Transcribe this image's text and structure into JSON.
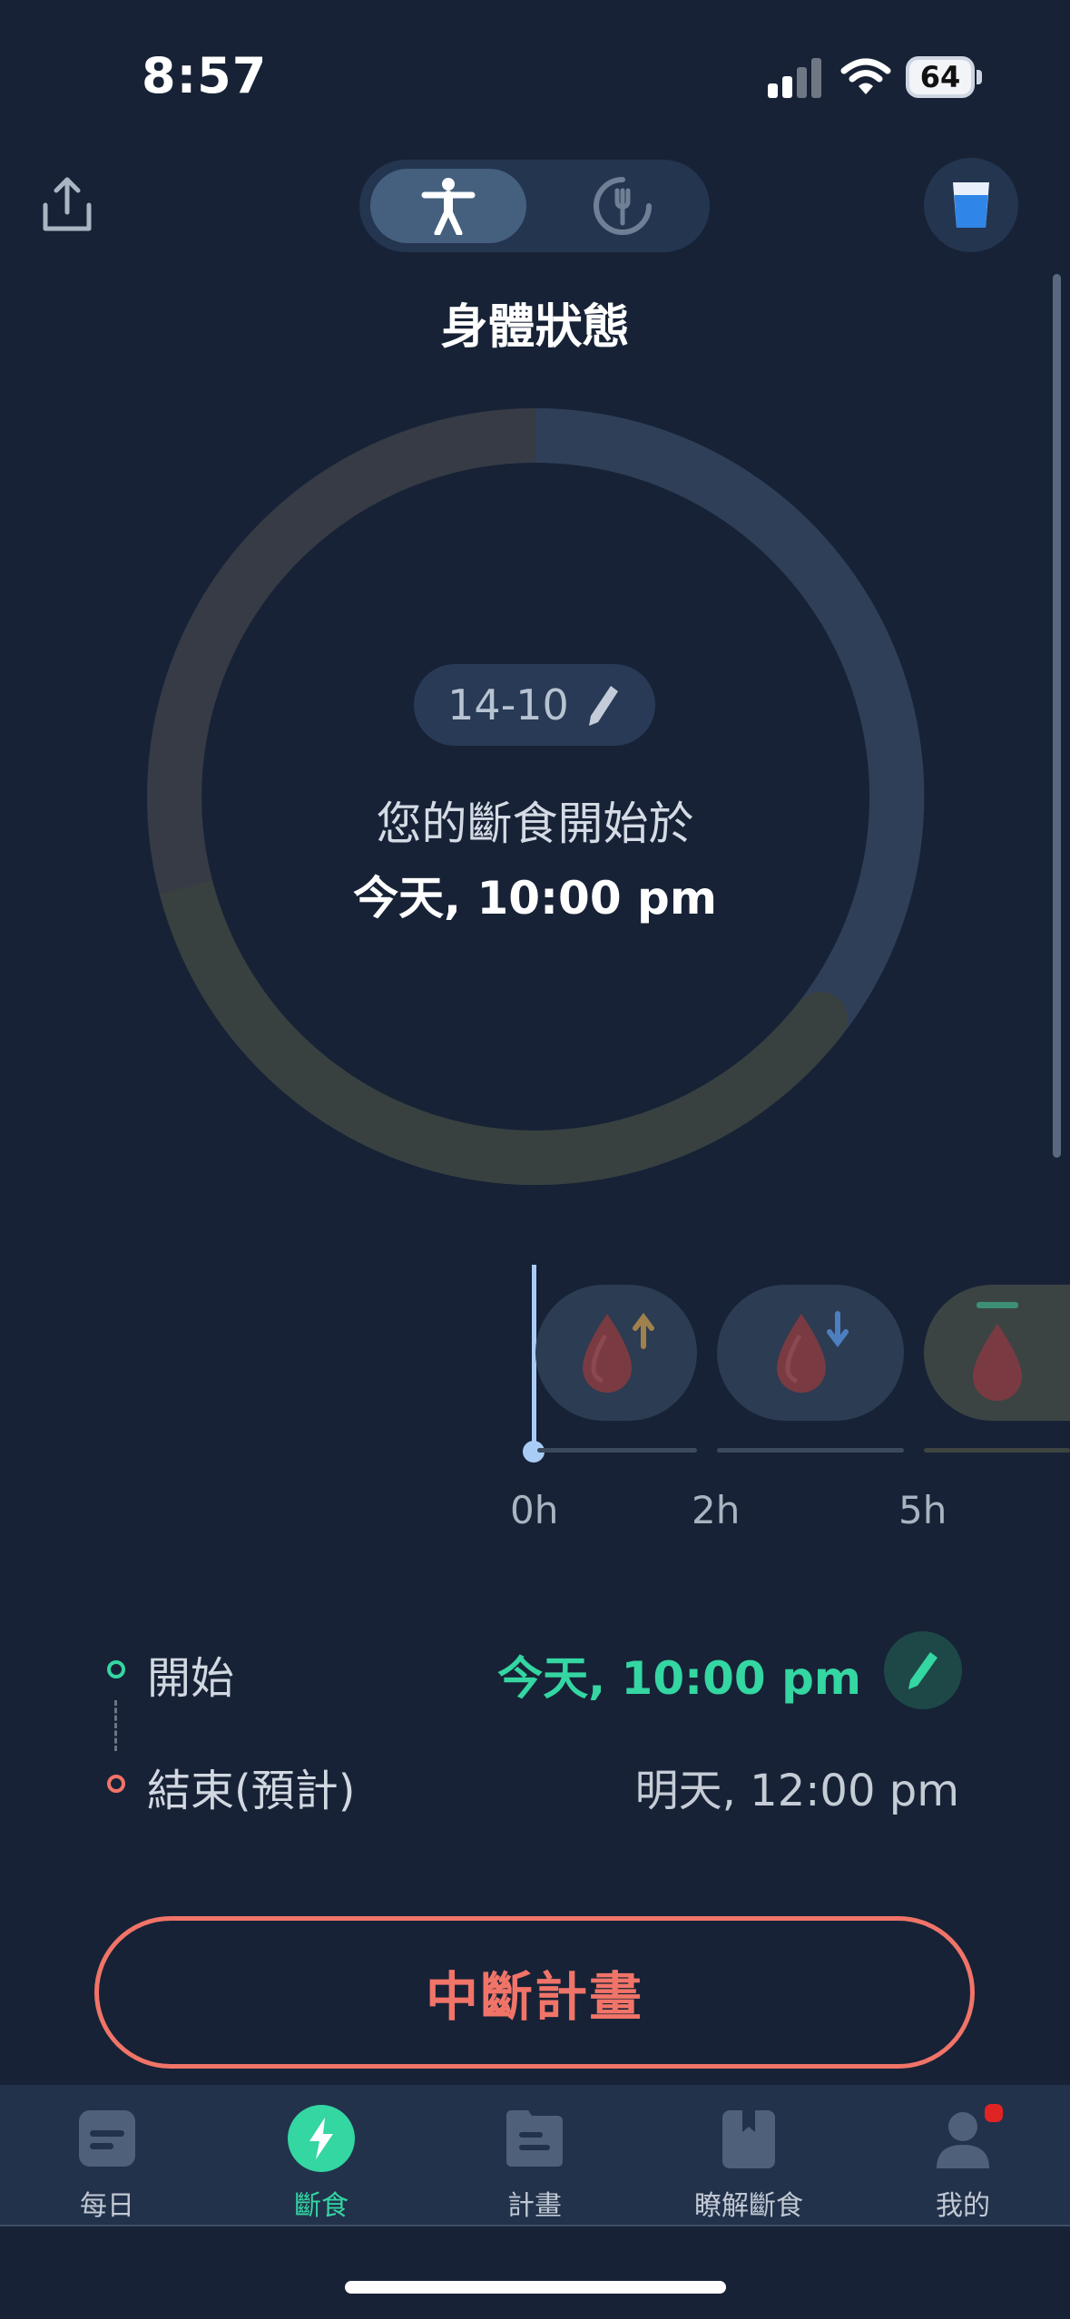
{
  "status_bar": {
    "time": "8:57",
    "battery": "64"
  },
  "header": {
    "title": "身體狀態"
  },
  "ring": {
    "plan_label": "14-10",
    "start_caption": "您的斷食開始於",
    "start_time": "今天, 10:00 pm"
  },
  "timeline": {
    "labels": [
      "0h",
      "2h",
      "5h"
    ]
  },
  "schedule": {
    "start_label": "開始",
    "start_value": "今天, 10:00 pm",
    "end_label": "結束(預計)",
    "end_value": "明天, 12:00 pm"
  },
  "actions": {
    "break_label": "中斷計畫"
  },
  "tabbar": {
    "items": [
      {
        "label": "每日",
        "icon": "daily-icon"
      },
      {
        "label": "斷食",
        "icon": "bolt-icon"
      },
      {
        "label": "計畫",
        "icon": "plan-icon"
      },
      {
        "label": "瞭解斷食",
        "icon": "bookmark-icon"
      },
      {
        "label": "我的",
        "icon": "profile-icon"
      }
    ],
    "active_index": 1
  },
  "colors": {
    "background": "#172236",
    "accent_green": "#34d6a2",
    "accent_red": "#f17468"
  }
}
